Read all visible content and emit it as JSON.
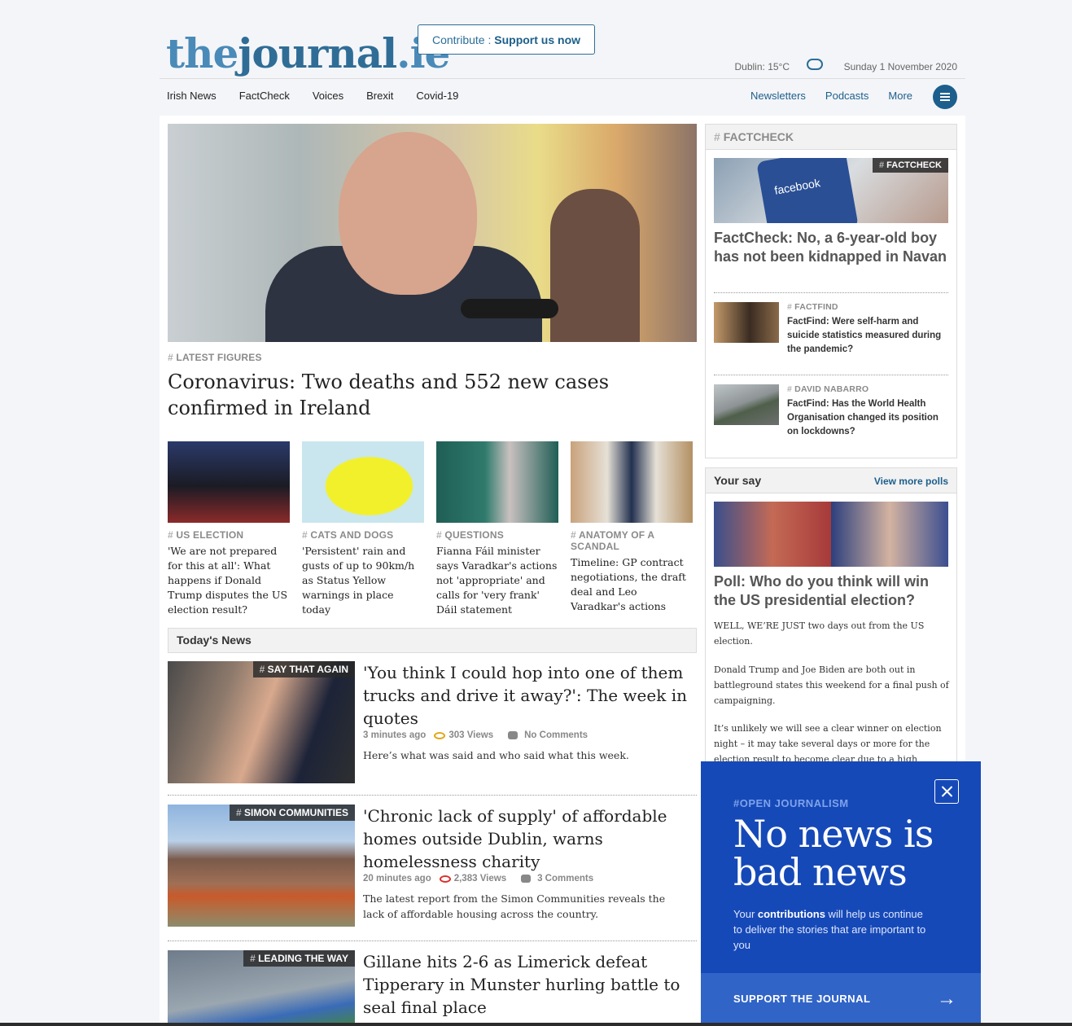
{
  "header": {
    "logo": {
      "part1": "the",
      "part2": "journal",
      "part3": ".ie"
    },
    "contribute_prefix": "Contribute : ",
    "contribute_link": "Support us now",
    "weather": "Dublin: 15°C",
    "date": "Sunday 1 November 2020",
    "nav_left": [
      "Irish News",
      "FactCheck",
      "Voices",
      "Brexit",
      "Covid-19"
    ],
    "nav_right": [
      "Newsletters",
      "Podcasts",
      "More"
    ]
  },
  "hero": {
    "tag": "LATEST FIGURES",
    "title": "Coronavirus: Two deaths and 552 new cases confirmed in Ireland"
  },
  "minis": [
    {
      "tag": "US ELECTION",
      "headline": "'We are not prepared for this at all': What happens if Donald Trump disputes the US election result?"
    },
    {
      "tag": "CATS AND DOGS",
      "headline": "'Persistent' rain and gusts of up to 90km/h as Status Yellow warnings in place today"
    },
    {
      "tag": "QUESTIONS",
      "headline": "Fianna Fáil minister says Varadkar's actions not 'appropriate' and calls for 'very frank' Dáil statement"
    },
    {
      "tag": "ANATOMY OF A SCANDAL",
      "headline": "Timeline: GP contract negotiations, the draft deal and Leo Varadkar's actions"
    }
  ],
  "todays_news": {
    "heading": "Today's News",
    "stories": [
      {
        "badge": "SAY THAT AGAIN",
        "headline": "'You think I could hop into one of them trucks and drive it away?': The week in quotes",
        "time": "3 minutes ago",
        "views": "303 Views",
        "comments": "No Comments",
        "summary": "Here’s what was said and who said what this week."
      },
      {
        "badge": "SIMON COMMUNITIES",
        "headline": "'Chronic lack of supply' of affordable homes outside Dublin, warns homelessness charity",
        "time": "20 minutes ago",
        "views": "2,383 Views",
        "comments": "3 Comments",
        "summary": "The latest report from the Simon Communities reveals the lack of affordable housing across the country."
      },
      {
        "badge": "LEADING THE WAY",
        "headline": "Gillane hits 2-6 as Limerick defeat Tipperary in Munster hurling battle to seal final place"
      }
    ]
  },
  "factcheck": {
    "heading": "FACTCHECK",
    "main_badge": "FACTCHECK",
    "main_title": "FactCheck: No, a 6-year-old boy has not been kidnapped in Navan",
    "phone_text": "facebook",
    "items": [
      {
        "tag": "FACTFIND",
        "headline": "FactFind: Were self-harm and suicide statistics measured during the pandemic?"
      },
      {
        "tag": "DAVID NABARRO",
        "headline": "FactFind: Has the World Health Organisation changed its position on lockdowns?"
      }
    ]
  },
  "poll": {
    "heading": "Your say",
    "link": "View more polls",
    "title": "Poll: Who do you think will win the US presidential election?",
    "paragraphs": [
      "WELL, WE’RE JUST two days out from the US election.",
      "Donald Trump and Joe Biden are both out in battleground states this weekend for a final push of campaigning.",
      "It’s unlikely we will see a clear winner on election night – it may take several days or more for the election result to become clear due to a high volume of"
    ]
  },
  "popup": {
    "kicker": "#OPEN JOURNALISM",
    "headline": "No news is bad news",
    "text_before": "Your ",
    "text_bold": "contributions",
    "text_after": " will help us continue to deliver the stories that are important to you",
    "cta": "SUPPORT THE JOURNAL"
  }
}
